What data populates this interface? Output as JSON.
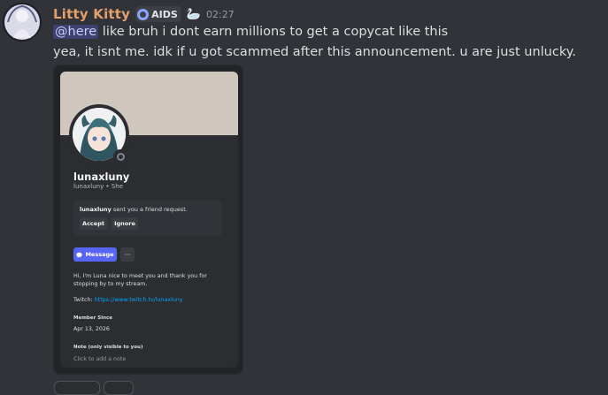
{
  "message": {
    "username": "Litty Kitty",
    "tag": "AIDS",
    "emoji": "🦢",
    "timestamp": "02:27",
    "mention": "@here",
    "line1_rest": " like bruh i dont earn millions to get a copycat like this",
    "line2": "yea, it isnt me. idk if u got scammed after this announcement. u are just unlucky.",
    "colors": {
      "username": "#e3a06a",
      "mention_bg": "#5865f2",
      "banner": "#cfc7bd"
    }
  },
  "card": {
    "display_name": "lunaxluny",
    "sub": "lunaxluny • She",
    "friend_request_user": "lunaxluny",
    "friend_request_text": " sent you a friend request.",
    "accept": "Accept",
    "ignore": "Ignore",
    "message_button": "Message",
    "more": "···",
    "bio": "Hi, I'm Luna nice to meet you and thank you for stopping by to my stream.",
    "twitch_label": "Twitch: ",
    "twitch_link": "https://www.twitch.tv/lunaxluny",
    "member_since_label": "Member Since",
    "member_since": "Apr 13, 2026",
    "note_label": "Note (only visible to you)",
    "note_placeholder": "Click to add a note"
  }
}
